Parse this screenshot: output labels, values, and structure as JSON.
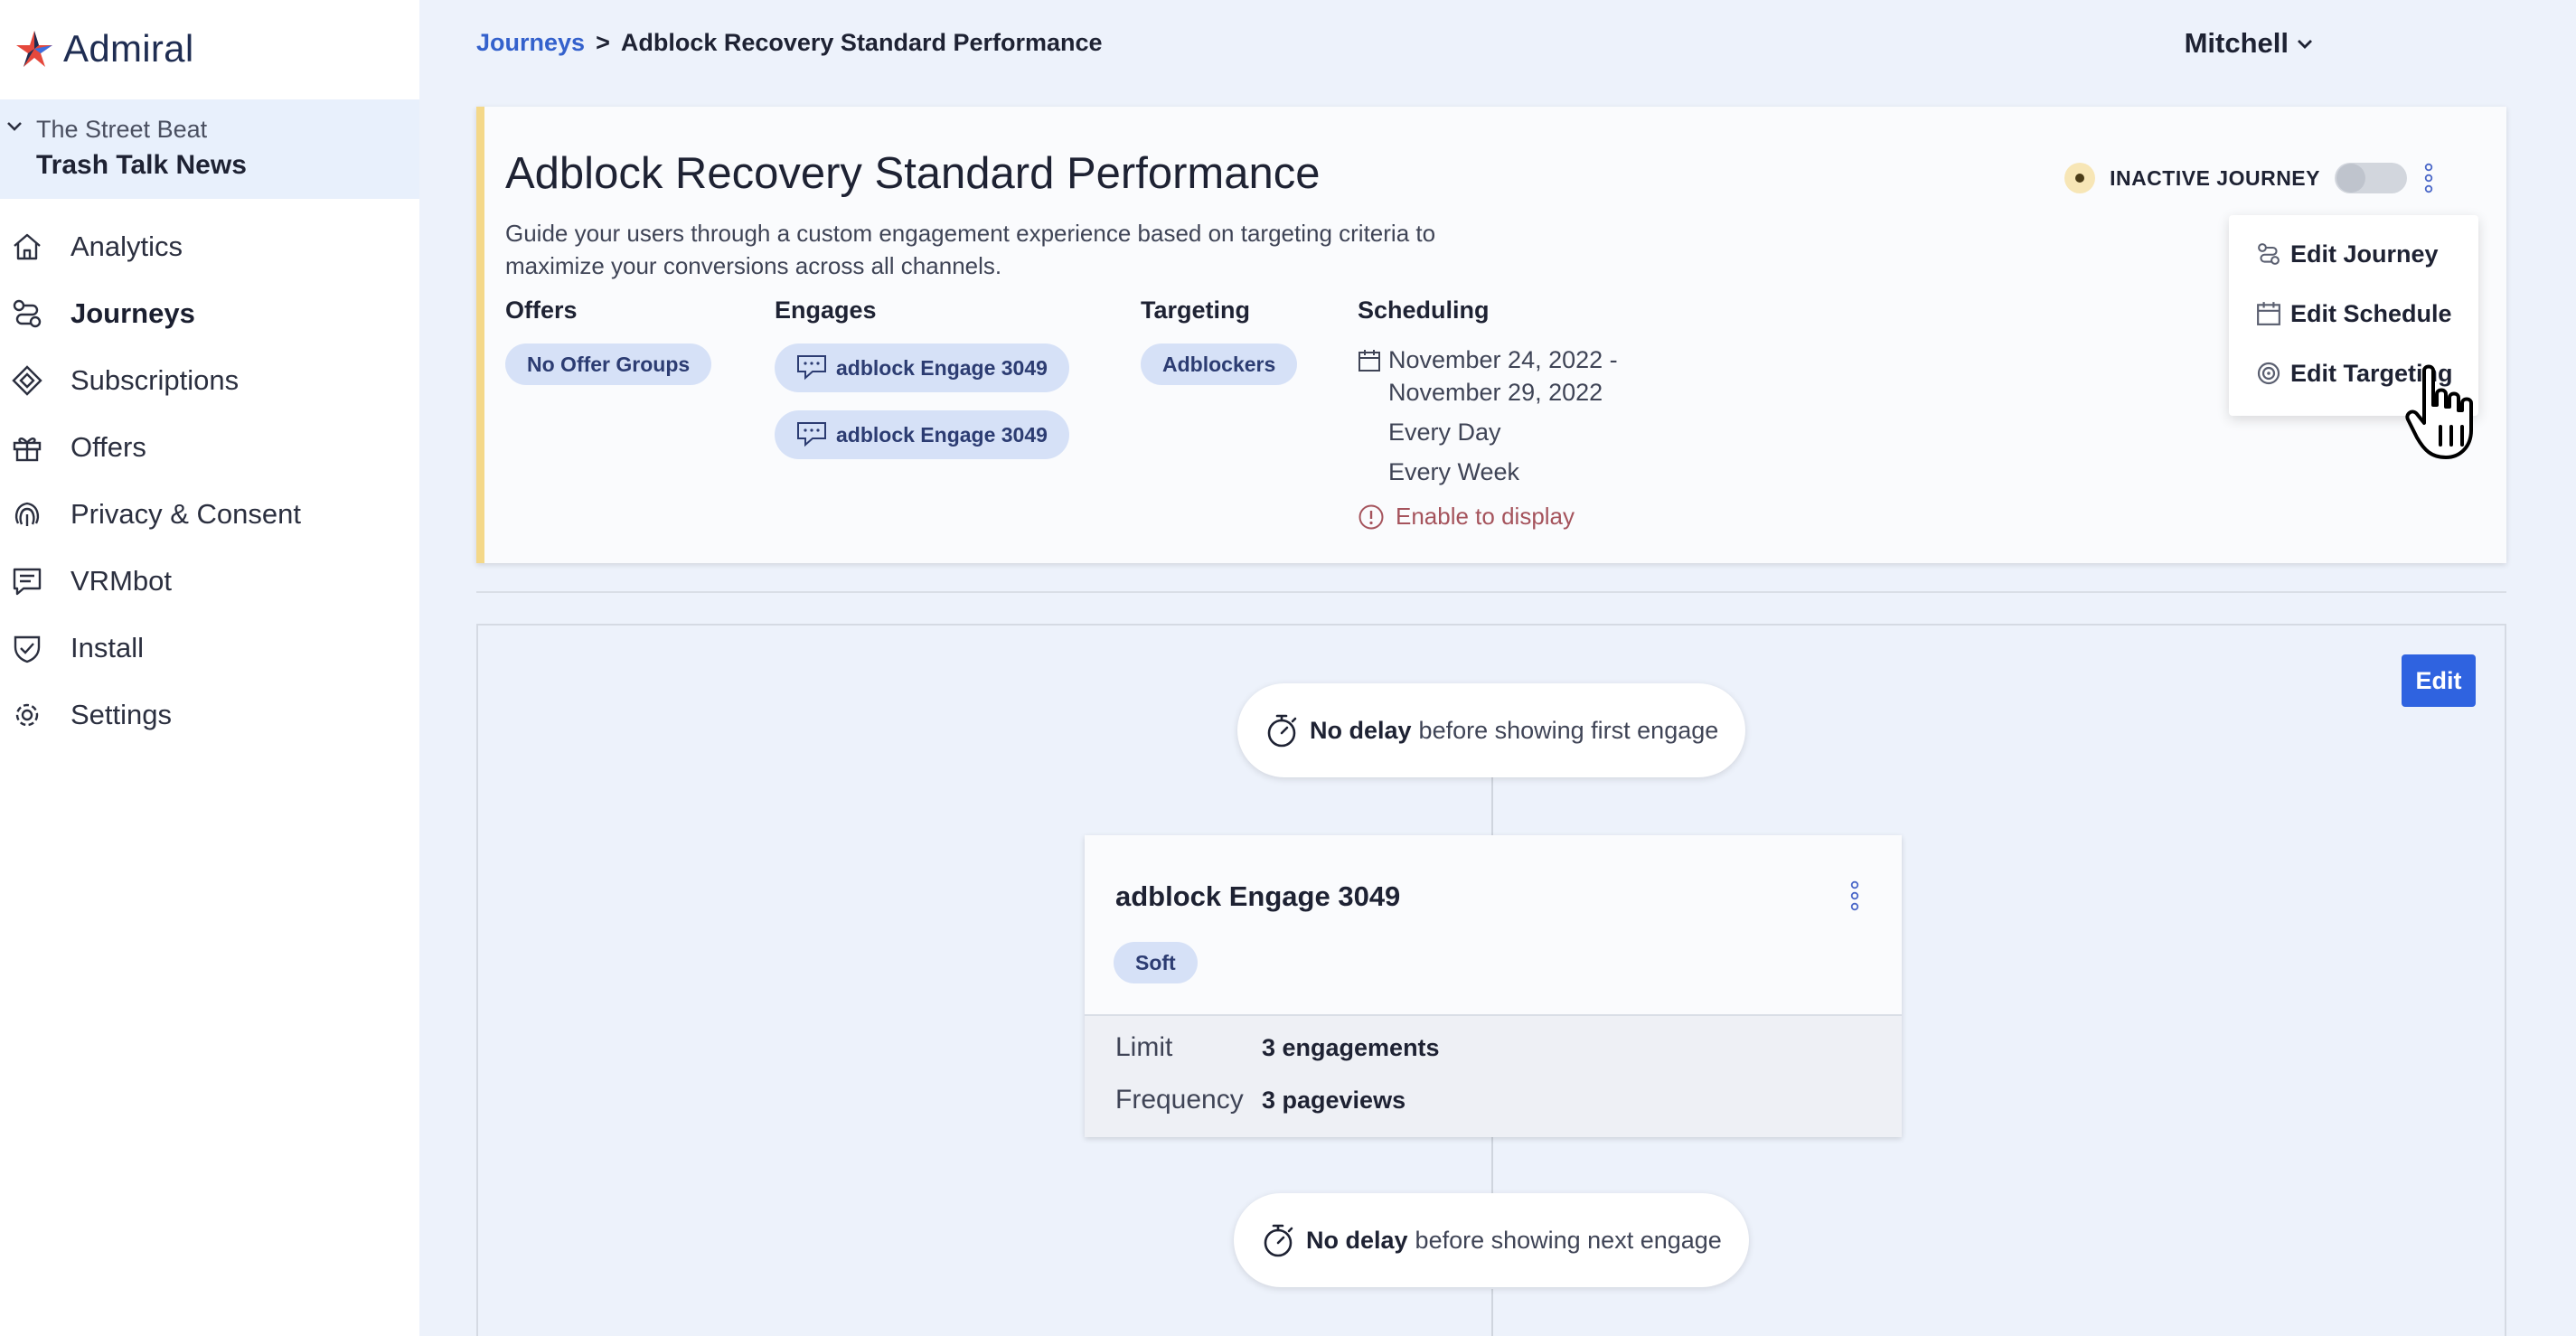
{
  "brand": {
    "name": "Admiral",
    "icon": "admiral-logo-icon"
  },
  "property": {
    "site": "The Street Beat",
    "name": "Trash Talk News"
  },
  "sidebar": {
    "items": [
      {
        "label": "Analytics",
        "icon": "home-icon"
      },
      {
        "label": "Journeys",
        "icon": "journeys-icon",
        "active": true
      },
      {
        "label": "Subscriptions",
        "icon": "subscriptions-icon"
      },
      {
        "label": "Offers",
        "icon": "gift-icon"
      },
      {
        "label": "Privacy & Consent",
        "icon": "fingerprint-icon"
      },
      {
        "label": "VRMbot",
        "icon": "chat-icon"
      },
      {
        "label": "Install",
        "icon": "shield-check-icon"
      },
      {
        "label": "Settings",
        "icon": "gear-icon"
      }
    ]
  },
  "breadcrumb": {
    "parent": "Journeys",
    "separator": ">",
    "current": "Adblock Recovery Standard Performance"
  },
  "user": {
    "name": "Mitchell"
  },
  "journey": {
    "title": "Adblock Recovery Standard Performance",
    "description": "Guide your users through a custom engagement experience based on targeting criteria to maximize your conversions across all channels.",
    "status_label": "INACTIVE JOURNEY",
    "offers": {
      "heading": "Offers",
      "value": "No Offer Groups"
    },
    "engages": {
      "heading": "Engages",
      "items": [
        "adblock Engage 3049",
        "adblock Engage 3049"
      ]
    },
    "targeting": {
      "heading": "Targeting",
      "value": "Adblockers"
    },
    "scheduling": {
      "heading": "Scheduling",
      "date_start": "November 24, 2022 -",
      "date_end": "November 29, 2022",
      "repeat_1": "Every Day",
      "repeat_2": "Every Week",
      "warning": "Enable to display"
    }
  },
  "menu": {
    "edit_journey": "Edit Journey",
    "edit_schedule": "Edit Schedule",
    "edit_targeting": "Edit Targeting"
  },
  "flow": {
    "edit_label": "Edit",
    "delay_first": {
      "bold": "No delay",
      "text": "before showing first engage"
    },
    "delay_next": {
      "bold": "No delay",
      "text": "before showing next engage"
    },
    "engage": {
      "title": "adblock Engage 3049",
      "tag": "Soft",
      "limit_label": "Limit",
      "limit_value": "3 engagements",
      "frequency_label": "Frequency",
      "frequency_value": "3 pageviews"
    }
  },
  "colors": {
    "accent": "#2f63e0",
    "link": "#3461cc",
    "pill_bg": "#d6e1f7",
    "status_yellow": "#f4d889",
    "warning": "#a5535c"
  }
}
